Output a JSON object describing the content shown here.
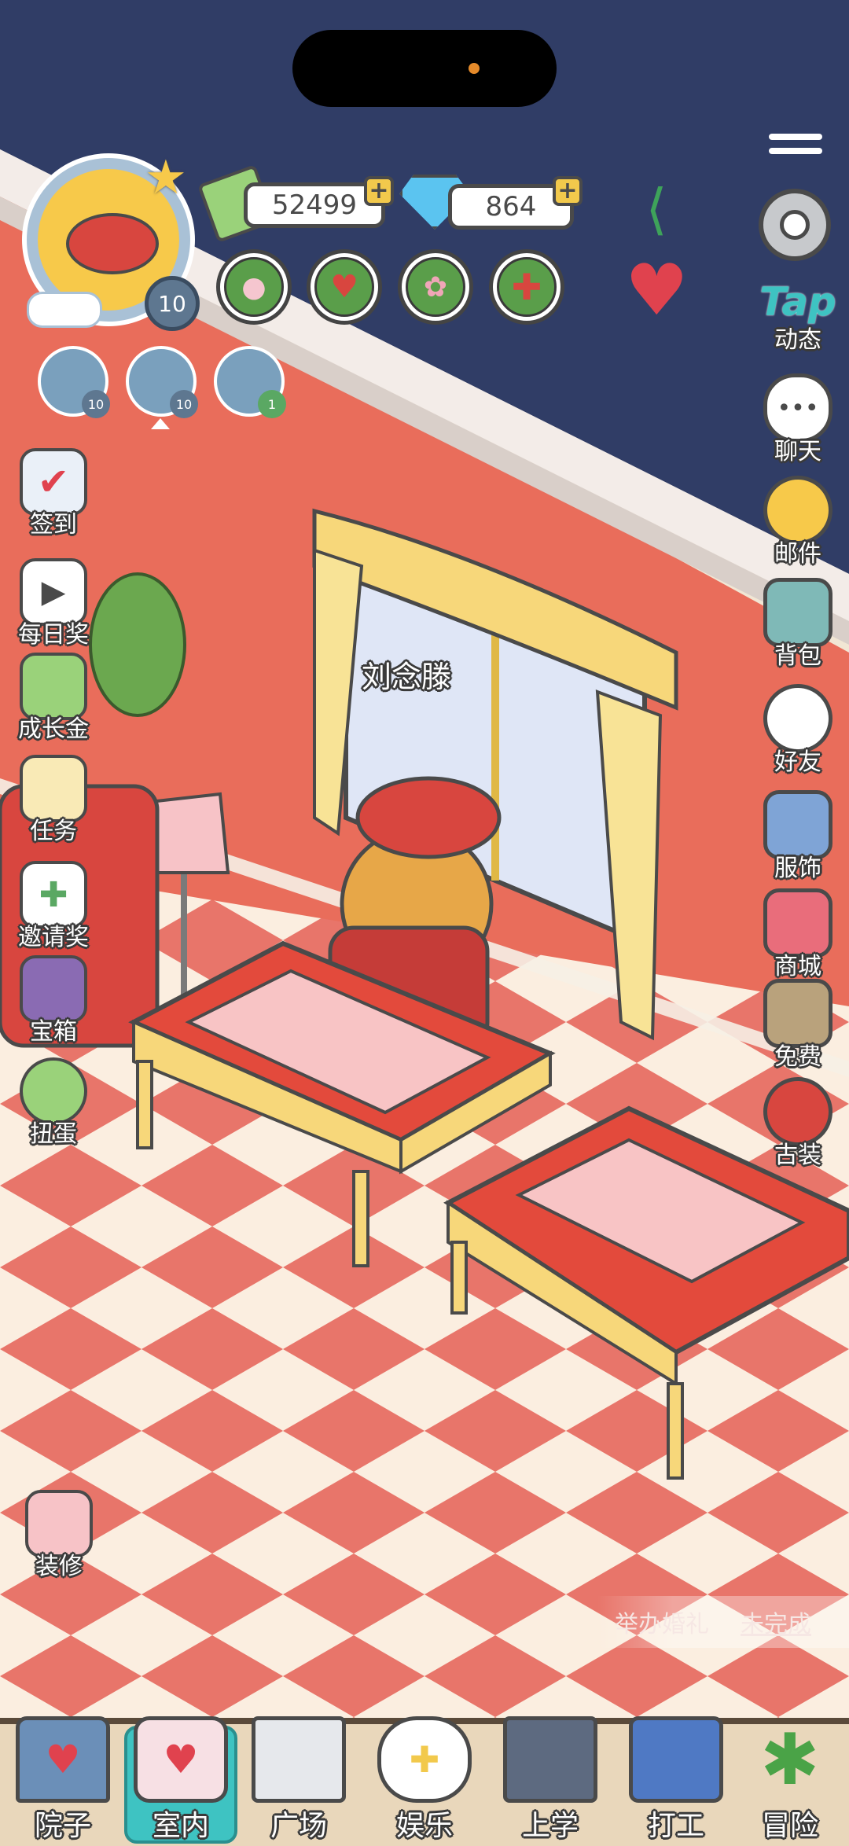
{
  "player": {
    "level": "10",
    "name": "刘念滕"
  },
  "currency": {
    "coins": "52499",
    "gems": "864"
  },
  "pets": [
    {
      "level": "10"
    },
    {
      "level": "10"
    },
    {
      "level": "1"
    }
  ],
  "right_menu": {
    "tap_logo": "Tap",
    "tap_label": "动态",
    "chat": "聊天",
    "mail": "邮件",
    "bag": "背包",
    "friends": "好友",
    "outfit": "服饰",
    "shop": "商城",
    "free": "免费",
    "costume": "古装"
  },
  "left_menu": {
    "checkin": "签到",
    "daily": "每日奖",
    "growth": "成长金",
    "tasks": "任务",
    "invite": "邀请奖",
    "chest": "宝箱",
    "gacha": "扭蛋",
    "decorate": "装修"
  },
  "quest": {
    "title": "举办婚礼",
    "status": "未完成"
  },
  "bottom_nav": [
    {
      "label": "院子"
    },
    {
      "label": "室内"
    },
    {
      "label": "广场"
    },
    {
      "label": "娱乐"
    },
    {
      "label": "上学"
    },
    {
      "label": "打工"
    },
    {
      "label": "冒险"
    }
  ],
  "colors": {
    "sky": "#303d66",
    "wall": "#e96d5b",
    "floor_red": "#e8756a",
    "floor_light": "#fbeee0",
    "accent_teal": "#3ec3c2"
  }
}
